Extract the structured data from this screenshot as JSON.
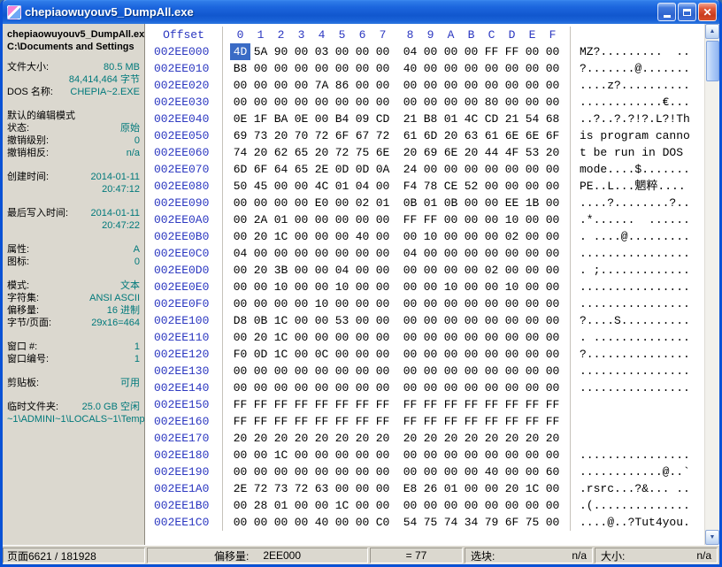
{
  "window": {
    "title": "chepiaowuyouv5_DumpAll.exe"
  },
  "icons": {
    "close": "✕",
    "scroll_up": "▲",
    "scroll_down": "▼"
  },
  "sidebar": {
    "file_name": "chepiaowuyouv5_DumpAll.ex",
    "file_path": "C:\\Documents and Settings",
    "sections": [
      {
        "rows": [
          {
            "label": "文件大小:",
            "value": "80.5 MB"
          },
          {
            "label": "",
            "value": "84,414,464 字节"
          },
          {
            "label": "DOS 名称:",
            "value": "CHEPIA~2.EXE"
          }
        ]
      },
      {
        "header": "默认的编辑模式",
        "rows": [
          {
            "label": "状态:",
            "value": "原始"
          },
          {
            "label": "撤销级别:",
            "value": "0"
          },
          {
            "label": "撤销相反:",
            "value": "n/a"
          }
        ]
      },
      {
        "rows": [
          {
            "label": "创建时间:",
            "value": "2014-01-11"
          },
          {
            "label": "",
            "value": "20:47:12"
          }
        ]
      },
      {
        "rows": [
          {
            "label": "最后写入时间:",
            "value": "2014-01-11"
          },
          {
            "label": "",
            "value": "20:47:22"
          }
        ]
      },
      {
        "rows": [
          {
            "label": "属性:",
            "value": "A"
          },
          {
            "label": "图标:",
            "value": "0"
          }
        ]
      },
      {
        "rows": [
          {
            "label": "模式:",
            "value": "文本"
          },
          {
            "label": "字符集:",
            "value": "ANSI ASCII"
          },
          {
            "label": "偏移量:",
            "value": "16 进制"
          },
          {
            "label": "字节/页面:",
            "value": "29x16=464"
          }
        ]
      },
      {
        "rows": [
          {
            "label": "窗口 #:",
            "value": "1"
          },
          {
            "label": "窗口编号:",
            "value": "1"
          }
        ]
      },
      {
        "rows": [
          {
            "label": "剪贴板:",
            "value": "可用"
          }
        ]
      },
      {
        "rows": [
          {
            "label": "临时文件夹:",
            "value": "25.0 GB 空闲"
          },
          {
            "label": "",
            "value": "~1\\ADMINI~1\\LOCALS~1\\Temp"
          }
        ]
      }
    ]
  },
  "hex": {
    "header": {
      "offset_label": "Offset",
      "columns": [
        "0",
        "1",
        "2",
        "3",
        "4",
        "5",
        "6",
        "7",
        "8",
        "9",
        "A",
        "B",
        "C",
        "D",
        "E",
        "F"
      ]
    },
    "selection": {
      "row": 0,
      "byte": 0
    },
    "rows": [
      {
        "offset": "002EE000",
        "bytes": [
          "4D",
          "5A",
          "90",
          "00",
          "03",
          "00",
          "00",
          "00",
          "04",
          "00",
          "00",
          "00",
          "FF",
          "FF",
          "00",
          "00"
        ],
        "ascii": "MZ?.........  .."
      },
      {
        "offset": "002EE010",
        "bytes": [
          "B8",
          "00",
          "00",
          "00",
          "00",
          "00",
          "00",
          "00",
          "40",
          "00",
          "00",
          "00",
          "00",
          "00",
          "00",
          "00"
        ],
        "ascii": "?.......@......."
      },
      {
        "offset": "002EE020",
        "bytes": [
          "00",
          "00",
          "00",
          "00",
          "7A",
          "86",
          "00",
          "00",
          "00",
          "00",
          "00",
          "00",
          "00",
          "00",
          "00",
          "00"
        ],
        "ascii": "....z?.........."
      },
      {
        "offset": "002EE030",
        "bytes": [
          "00",
          "00",
          "00",
          "00",
          "00",
          "00",
          "00",
          "00",
          "00",
          "00",
          "00",
          "00",
          "80",
          "00",
          "00",
          "00"
        ],
        "ascii": "............€..."
      },
      {
        "offset": "002EE040",
        "bytes": [
          "0E",
          "1F",
          "BA",
          "0E",
          "00",
          "B4",
          "09",
          "CD",
          "21",
          "B8",
          "01",
          "4C",
          "CD",
          "21",
          "54",
          "68"
        ],
        "ascii": "..?..?.?!?.L?!Th"
      },
      {
        "offset": "002EE050",
        "bytes": [
          "69",
          "73",
          "20",
          "70",
          "72",
          "6F",
          "67",
          "72",
          "61",
          "6D",
          "20",
          "63",
          "61",
          "6E",
          "6E",
          "6F"
        ],
        "ascii": "is program canno"
      },
      {
        "offset": "002EE060",
        "bytes": [
          "74",
          "20",
          "62",
          "65",
          "20",
          "72",
          "75",
          "6E",
          "20",
          "69",
          "6E",
          "20",
          "44",
          "4F",
          "53",
          "20"
        ],
        "ascii": "t be run in DOS "
      },
      {
        "offset": "002EE070",
        "bytes": [
          "6D",
          "6F",
          "64",
          "65",
          "2E",
          "0D",
          "0D",
          "0A",
          "24",
          "00",
          "00",
          "00",
          "00",
          "00",
          "00",
          "00"
        ],
        "ascii": "mode....$......."
      },
      {
        "offset": "002EE080",
        "bytes": [
          "50",
          "45",
          "00",
          "00",
          "4C",
          "01",
          "04",
          "00",
          "F4",
          "78",
          "CE",
          "52",
          "00",
          "00",
          "00",
          "00"
        ],
        "ascii": "PE..L...魍粹...."
      },
      {
        "offset": "002EE090",
        "bytes": [
          "00",
          "00",
          "00",
          "00",
          "E0",
          "00",
          "02",
          "01",
          "0B",
          "01",
          "0B",
          "00",
          "00",
          "EE",
          "1B",
          "00"
        ],
        "ascii": "....?........?.."
      },
      {
        "offset": "002EE0A0",
        "bytes": [
          "00",
          "2A",
          "01",
          "00",
          "00",
          "00",
          "00",
          "00",
          "FF",
          "FF",
          "00",
          "00",
          "00",
          "10",
          "00",
          "00"
        ],
        "ascii": ".*......  ......"
      },
      {
        "offset": "002EE0B0",
        "bytes": [
          "00",
          "20",
          "1C",
          "00",
          "00",
          "00",
          "40",
          "00",
          "00",
          "10",
          "00",
          "00",
          "00",
          "02",
          "00",
          "00"
        ],
        "ascii": ". ....@........."
      },
      {
        "offset": "002EE0C0",
        "bytes": [
          "04",
          "00",
          "00",
          "00",
          "00",
          "00",
          "00",
          "00",
          "04",
          "00",
          "00",
          "00",
          "00",
          "00",
          "00",
          "00"
        ],
        "ascii": "................"
      },
      {
        "offset": "002EE0D0",
        "bytes": [
          "00",
          "20",
          "3B",
          "00",
          "00",
          "04",
          "00",
          "00",
          "00",
          "00",
          "00",
          "00",
          "02",
          "00",
          "00",
          "00"
        ],
        "ascii": ". ;............."
      },
      {
        "offset": "002EE0E0",
        "bytes": [
          "00",
          "00",
          "10",
          "00",
          "00",
          "10",
          "00",
          "00",
          "00",
          "00",
          "10",
          "00",
          "00",
          "10",
          "00",
          "00"
        ],
        "ascii": "................"
      },
      {
        "offset": "002EE0F0",
        "bytes": [
          "00",
          "00",
          "00",
          "00",
          "10",
          "00",
          "00",
          "00",
          "00",
          "00",
          "00",
          "00",
          "00",
          "00",
          "00",
          "00"
        ],
        "ascii": "................"
      },
      {
        "offset": "002EE100",
        "bytes": [
          "D8",
          "0B",
          "1C",
          "00",
          "00",
          "53",
          "00",
          "00",
          "00",
          "00",
          "00",
          "00",
          "00",
          "00",
          "00",
          "00"
        ],
        "ascii": "?....S.........."
      },
      {
        "offset": "002EE110",
        "bytes": [
          "00",
          "20",
          "1C",
          "00",
          "00",
          "00",
          "00",
          "00",
          "00",
          "00",
          "00",
          "00",
          "00",
          "00",
          "00",
          "00"
        ],
        "ascii": ". .............."
      },
      {
        "offset": "002EE120",
        "bytes": [
          "F0",
          "0D",
          "1C",
          "00",
          "0C",
          "00",
          "00",
          "00",
          "00",
          "00",
          "00",
          "00",
          "00",
          "00",
          "00",
          "00"
        ],
        "ascii": "?..............."
      },
      {
        "offset": "002EE130",
        "bytes": [
          "00",
          "00",
          "00",
          "00",
          "00",
          "00",
          "00",
          "00",
          "00",
          "00",
          "00",
          "00",
          "00",
          "00",
          "00",
          "00"
        ],
        "ascii": "................"
      },
      {
        "offset": "002EE140",
        "bytes": [
          "00",
          "00",
          "00",
          "00",
          "00",
          "00",
          "00",
          "00",
          "00",
          "00",
          "00",
          "00",
          "00",
          "00",
          "00",
          "00"
        ],
        "ascii": "................"
      },
      {
        "offset": "002EE150",
        "bytes": [
          "FF",
          "FF",
          "FF",
          "FF",
          "FF",
          "FF",
          "FF",
          "FF",
          "FF",
          "FF",
          "FF",
          "FF",
          "FF",
          "FF",
          "FF",
          "FF"
        ],
        "ascii": "                "
      },
      {
        "offset": "002EE160",
        "bytes": [
          "FF",
          "FF",
          "FF",
          "FF",
          "FF",
          "FF",
          "FF",
          "FF",
          "FF",
          "FF",
          "FF",
          "FF",
          "FF",
          "FF",
          "FF",
          "FF"
        ],
        "ascii": "                "
      },
      {
        "offset": "002EE170",
        "bytes": [
          "20",
          "20",
          "20",
          "20",
          "20",
          "20",
          "20",
          "20",
          "20",
          "20",
          "20",
          "20",
          "20",
          "20",
          "20",
          "20"
        ],
        "ascii": "                "
      },
      {
        "offset": "002EE180",
        "bytes": [
          "00",
          "00",
          "1C",
          "00",
          "00",
          "00",
          "00",
          "00",
          "00",
          "00",
          "00",
          "00",
          "00",
          "00",
          "00",
          "00"
        ],
        "ascii": "................"
      },
      {
        "offset": "002EE190",
        "bytes": [
          "00",
          "00",
          "00",
          "00",
          "00",
          "00",
          "00",
          "00",
          "00",
          "00",
          "00",
          "00",
          "40",
          "00",
          "00",
          "60"
        ],
        "ascii": "............@..`"
      },
      {
        "offset": "002EE1A0",
        "bytes": [
          "2E",
          "72",
          "73",
          "72",
          "63",
          "00",
          "00",
          "00",
          "E8",
          "26",
          "01",
          "00",
          "00",
          "20",
          "1C",
          "00"
        ],
        "ascii": ".rsrc...?&... .."
      },
      {
        "offset": "002EE1B0",
        "bytes": [
          "00",
          "28",
          "01",
          "00",
          "00",
          "1C",
          "00",
          "00",
          "00",
          "00",
          "00",
          "00",
          "00",
          "00",
          "00",
          "00"
        ],
        "ascii": ".(.............."
      },
      {
        "offset": "002EE1C0",
        "bytes": [
          "00",
          "00",
          "00",
          "00",
          "40",
          "00",
          "00",
          "C0",
          "54",
          "75",
          "74",
          "34",
          "79",
          "6F",
          "75",
          "00"
        ],
        "ascii": "....@..?Tut4you."
      }
    ]
  },
  "statusbar": {
    "page": "页面6621 / 181928",
    "offset_label": "偏移量:",
    "offset_value": "2EE000",
    "byte_value": "= 77",
    "block_label": "选块:",
    "block_value": "n/a",
    "size_label": "大小:",
    "size_value": "n/a"
  }
}
